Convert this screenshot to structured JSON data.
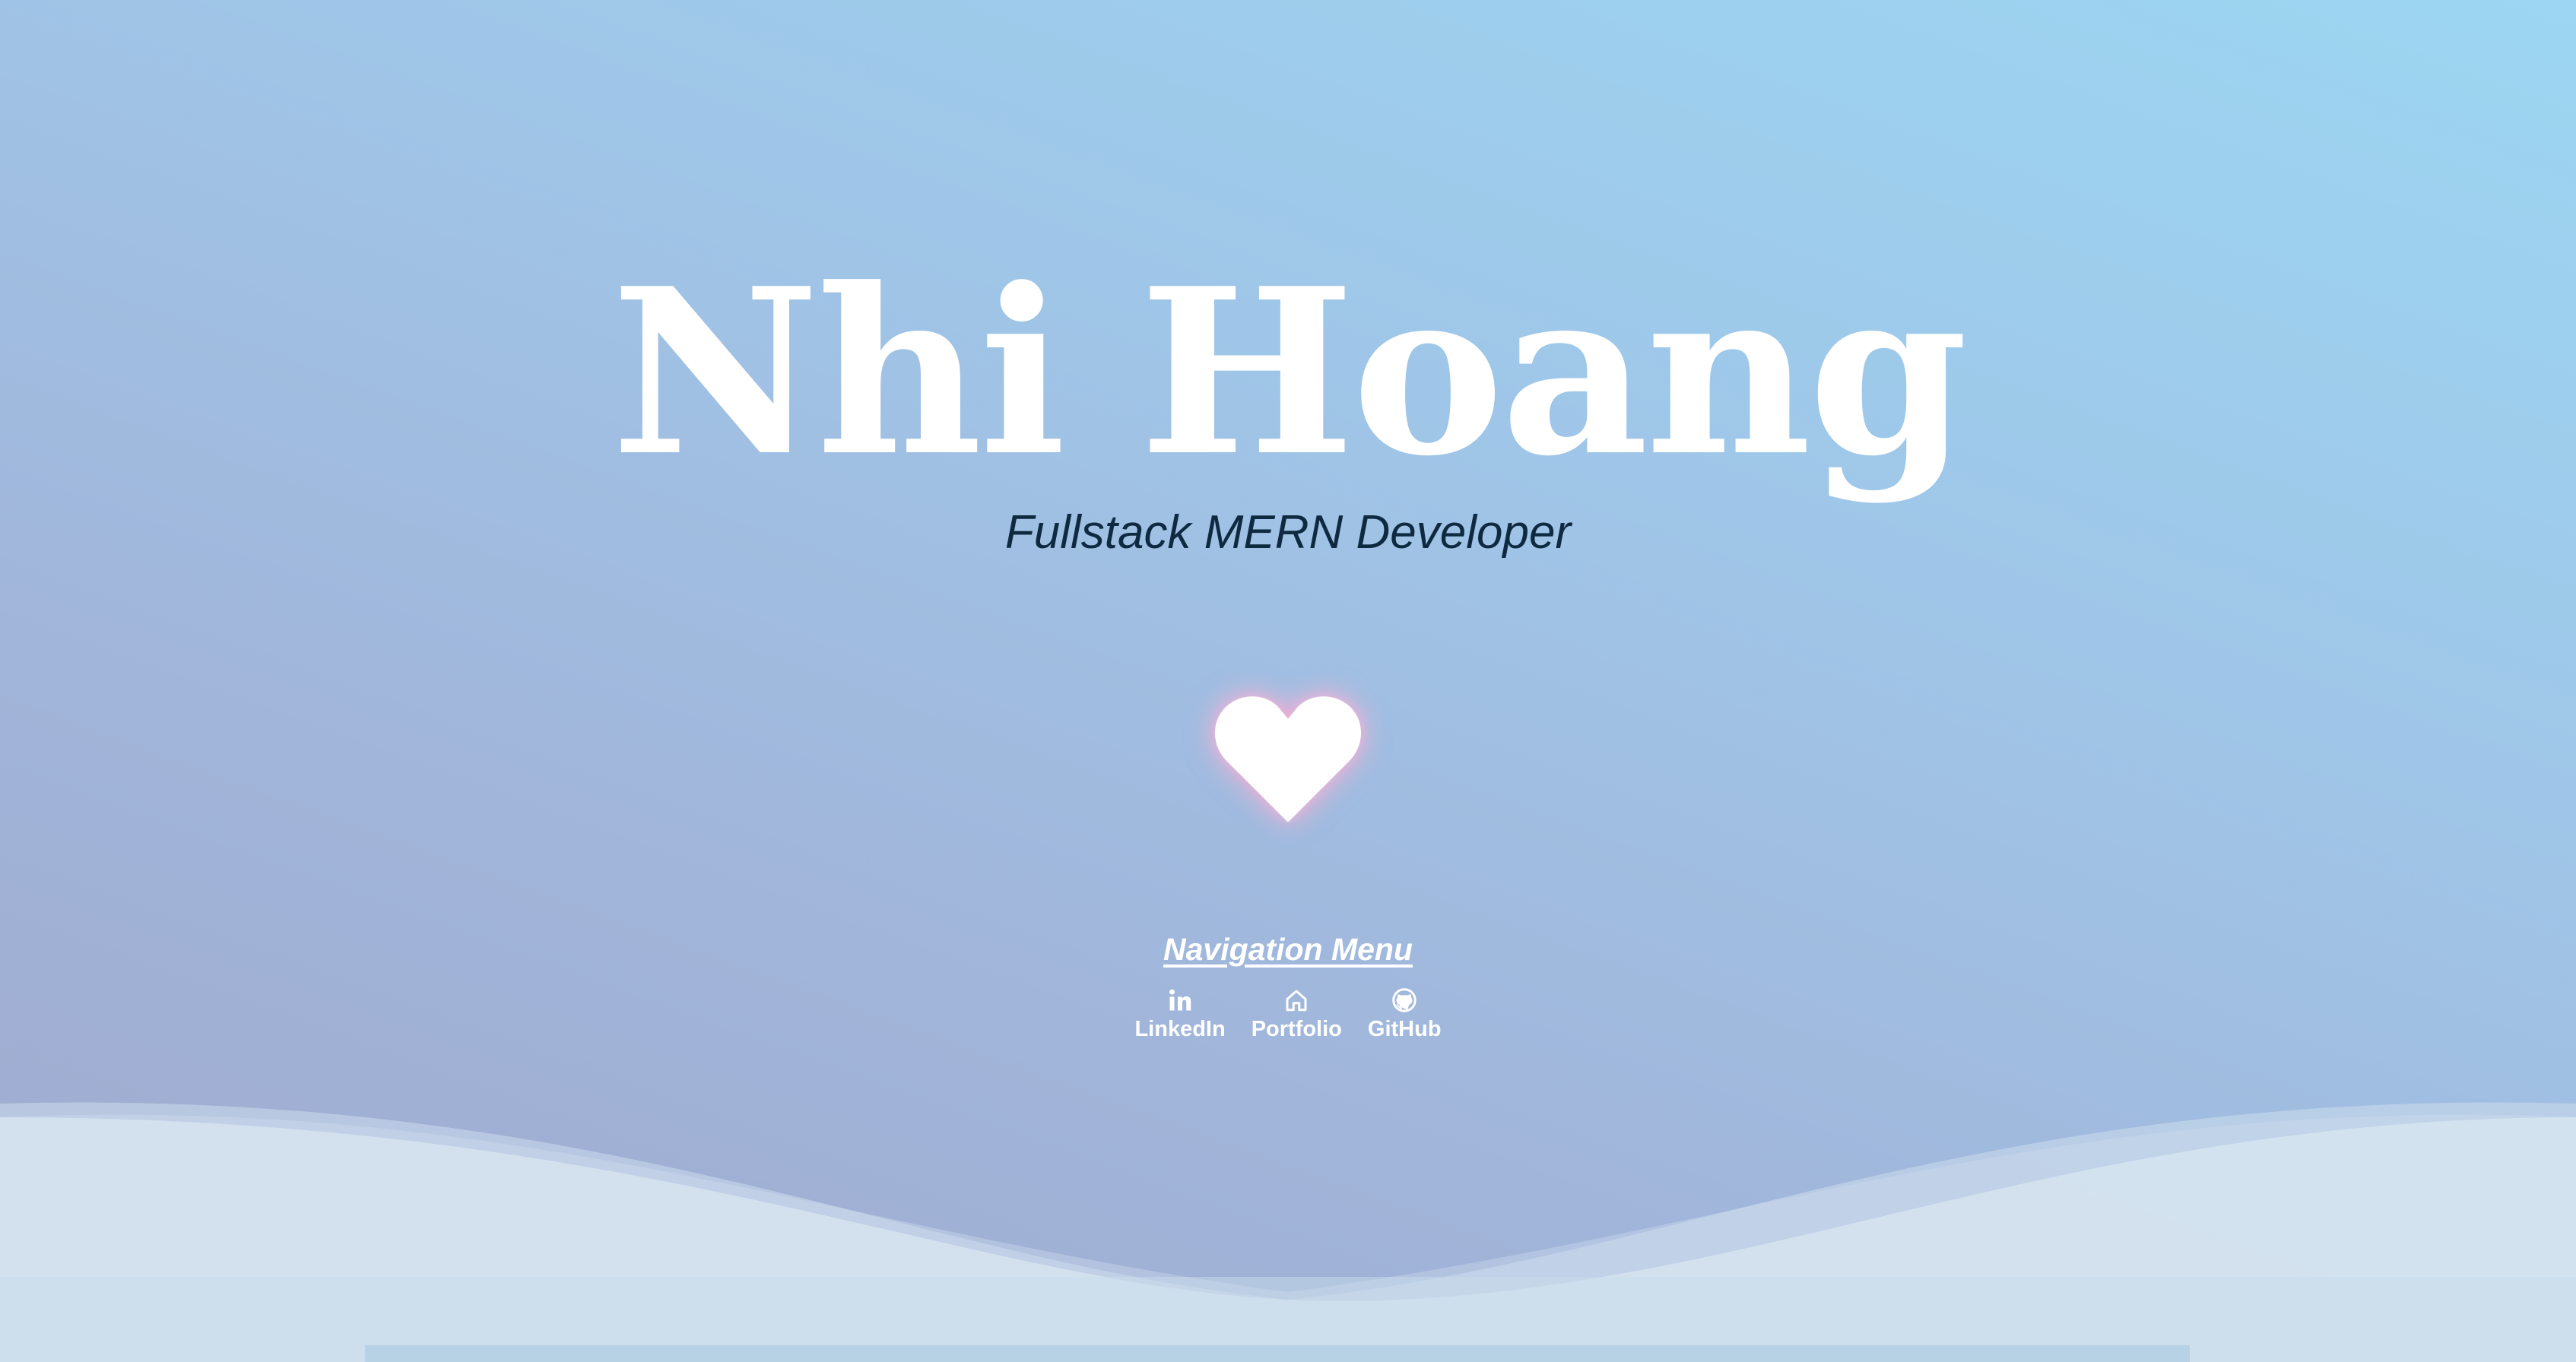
{
  "hero": {
    "name": "Nhi Hoang",
    "subtitle": "Fullstack MERN Developer"
  },
  "heart": {
    "icon": "heart-icon",
    "color": "#ffffff",
    "glow_color": "#ffb0d4"
  },
  "navigation": {
    "title": "Navigation Menu",
    "links": [
      {
        "label": "LinkedIn",
        "icon": "linkedin-icon"
      },
      {
        "label": "Portfolio",
        "icon": "home-icon"
      },
      {
        "label": "GitHub",
        "icon": "github-icon"
      }
    ]
  },
  "colors": {
    "background_top_right": "#9cd6f2",
    "background_bottom_left": "#9eaacd",
    "subtitle_text": "#0e2a40",
    "wave_light": "#d4e3ef"
  }
}
